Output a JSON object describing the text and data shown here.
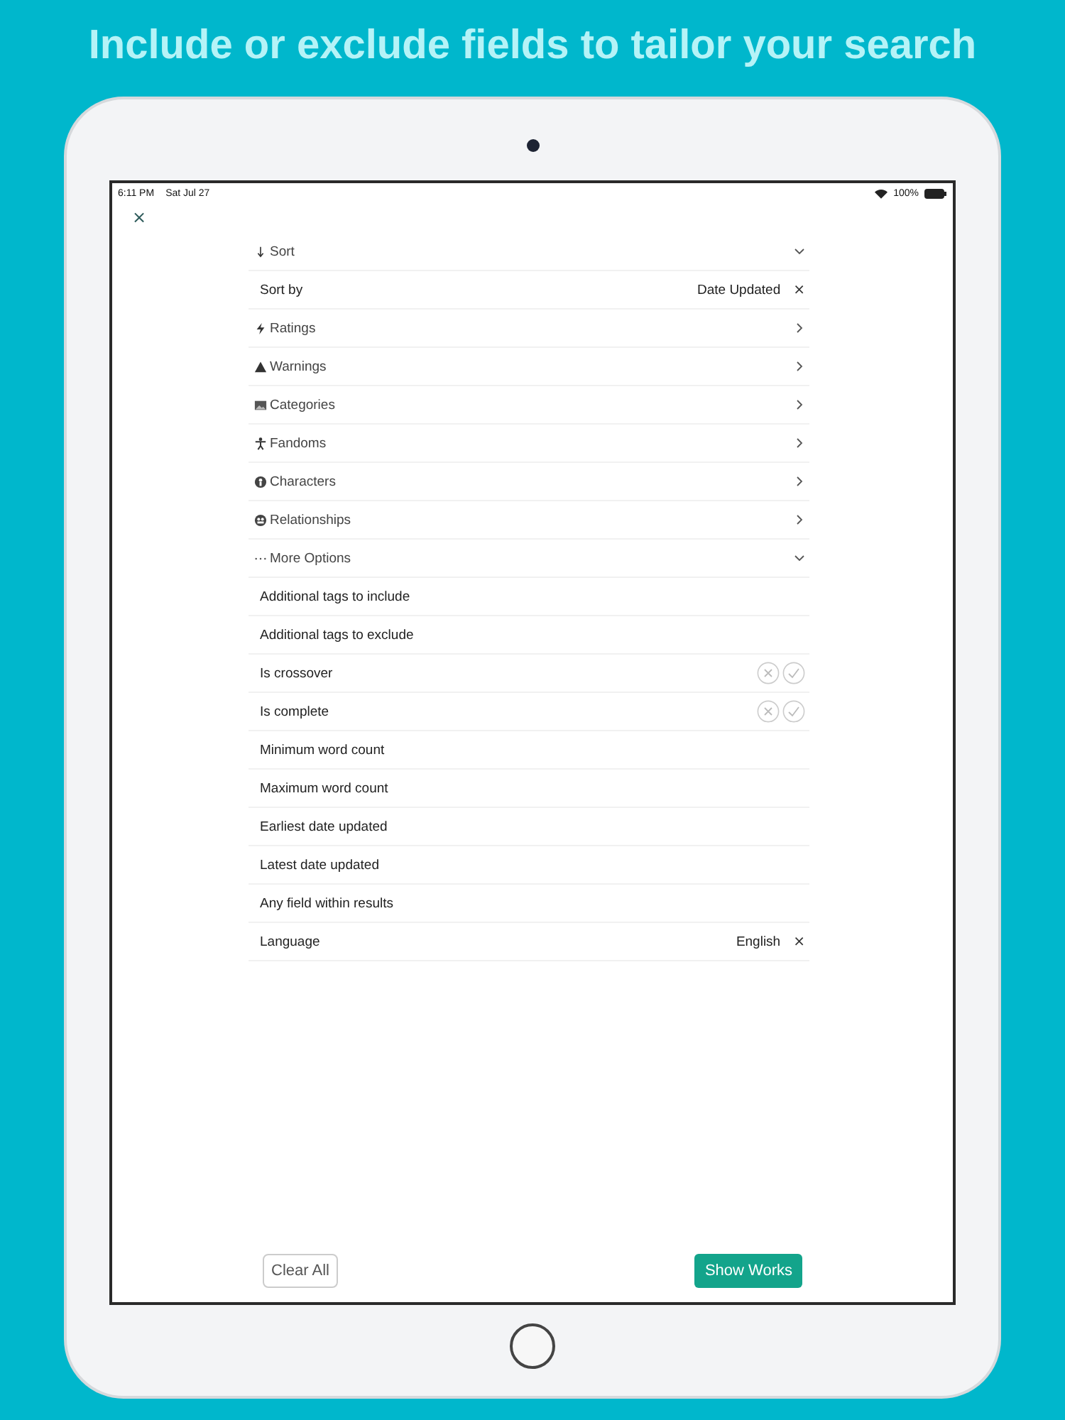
{
  "headline": "Include or exclude fields to tailor your search",
  "status_bar": {
    "time": "6:11 PM",
    "date": "Sat Jul 27",
    "battery": "100%"
  },
  "rows": [
    {
      "kind": "section",
      "label": "Sort",
      "expanded": true
    },
    {
      "kind": "field",
      "label": "Sort by",
      "value": "Date Updated",
      "clear": "×"
    },
    {
      "kind": "section",
      "label": "Ratings",
      "expanded": false
    },
    {
      "kind": "section",
      "label": "Warnings",
      "expanded": false
    },
    {
      "kind": "section",
      "label": "Categories",
      "expanded": false
    },
    {
      "kind": "section",
      "label": "Fandoms",
      "expanded": false
    },
    {
      "kind": "section",
      "label": "Characters",
      "expanded": false
    },
    {
      "kind": "section",
      "label": "Relationships",
      "expanded": false
    },
    {
      "kind": "section",
      "label": "More Options",
      "expanded": true
    },
    {
      "kind": "field",
      "label": "Additional tags to include"
    },
    {
      "kind": "field",
      "label": "Additional tags to exclude"
    },
    {
      "kind": "toggle",
      "label": "Is crossover",
      "exclude_selected": false,
      "include_selected": false
    },
    {
      "kind": "toggle",
      "label": "Is complete",
      "exclude_selected": false,
      "include_selected": false
    },
    {
      "kind": "field",
      "label": "Minimum word count"
    },
    {
      "kind": "field",
      "label": "Maximum word count"
    },
    {
      "kind": "field",
      "label": "Earliest date updated"
    },
    {
      "kind": "field",
      "label": "Latest date updated"
    },
    {
      "kind": "field",
      "label": "Any field within results"
    },
    {
      "kind": "field",
      "label": "Language",
      "value": "English",
      "clear": "×"
    }
  ],
  "close": "×",
  "buttons": {
    "clear": "Clear All",
    "show": "Show Works"
  }
}
